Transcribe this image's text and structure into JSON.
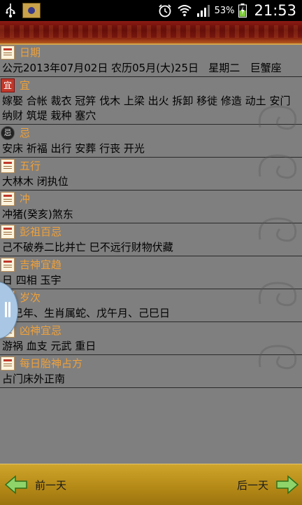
{
  "status_bar": {
    "battery_percent": "53%",
    "time": "21:53"
  },
  "sections": [
    {
      "title": "日期",
      "body": "公元2013年07月02日 农历05月(大)25日   星期二   巨蟹座"
    },
    {
      "title": "宜",
      "icon_char": "宜",
      "body": "嫁娶 合帐 裁衣 冠笄 伐木 上梁 出火 拆卸 移徙 修造 动土 安门 纳财 筑堤 栽种 塞穴"
    },
    {
      "title": "忌",
      "icon_char": "忌",
      "body": "安床 祈福 出行 安葬 行丧 开光"
    },
    {
      "title": "五行",
      "body": "大林木 闭执位"
    },
    {
      "title": "冲",
      "body": "冲猪(癸亥)煞东"
    },
    {
      "title": "彭祖百忌",
      "body": "己不破券二比并亡 巳不远行财物伏藏"
    },
    {
      "title": "吉神宜趋",
      "body": "日 四相 玉宇"
    },
    {
      "title": "岁次",
      "body": "癸巳年、生肖属蛇、戊午月、己巳日"
    },
    {
      "title": "凶神宜忌",
      "body": "游祸 血支 元武 重日"
    },
    {
      "title": "每日胎神占方",
      "body": "占门床外正南"
    }
  ],
  "bottom_nav": {
    "prev_label": "前一天",
    "next_label": "后一天"
  },
  "colors": {
    "section_title": "#f0a13a",
    "header_red": "#7c170f",
    "bottom_gold": "#b58a17",
    "background": "#7f7f7f"
  }
}
